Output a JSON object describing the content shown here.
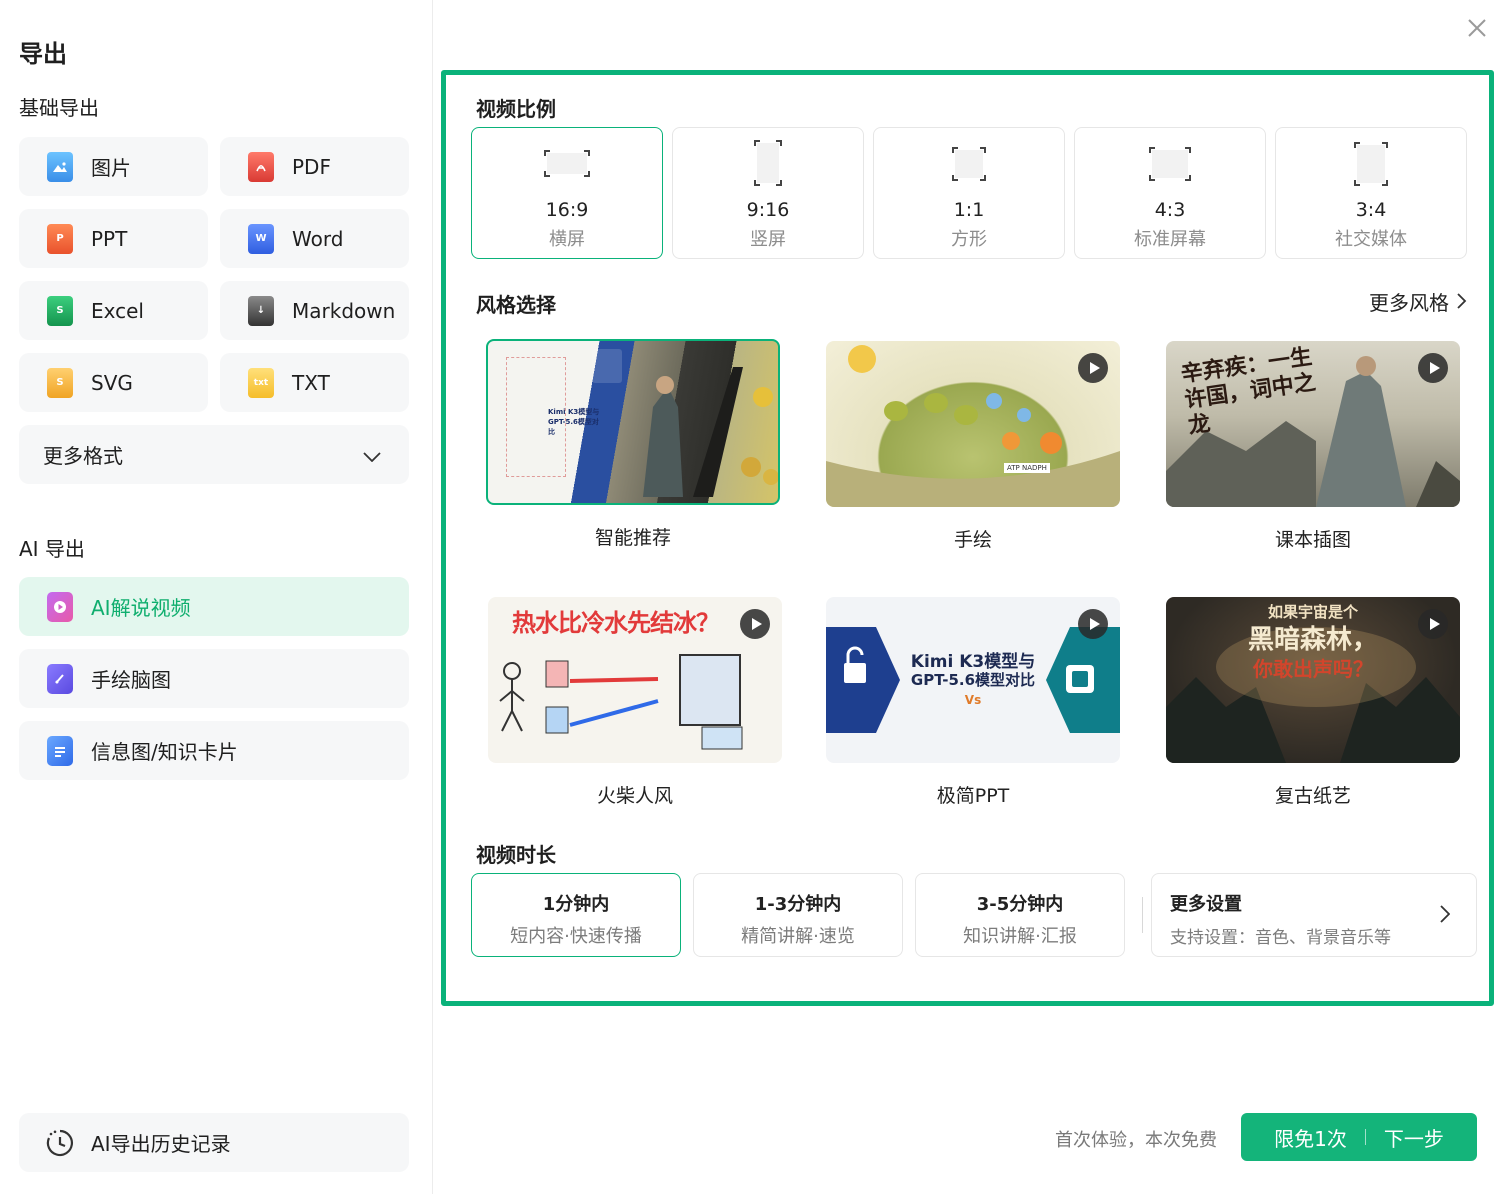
{
  "sidebar": {
    "title": "导出",
    "basic_section": "基础导出",
    "formats": [
      {
        "label": "图片",
        "icon": "image-icon",
        "color": "#3aa6f0"
      },
      {
        "label": "PDF",
        "icon": "pdf-icon",
        "color": "#e9524a"
      },
      {
        "label": "PPT",
        "icon": "ppt-icon",
        "color": "#f06a3a"
      },
      {
        "label": "Word",
        "icon": "word-icon",
        "color": "#3b6ee8"
      },
      {
        "label": "Excel",
        "icon": "excel-icon",
        "color": "#1da35c"
      },
      {
        "label": "Markdown",
        "icon": "markdown-icon",
        "color": "#555555"
      },
      {
        "label": "SVG",
        "icon": "svg-icon",
        "color": "#f2b33a"
      },
      {
        "label": "TXT",
        "icon": "txt-icon",
        "color": "#f5c33a"
      }
    ],
    "more_formats": "更多格式",
    "ai_section": "AI 导出",
    "ai_items": [
      {
        "label": "AI解说视频",
        "icon": "video-icon"
      },
      {
        "label": "手绘脑图",
        "icon": "mindmap-icon"
      },
      {
        "label": "信息图/知识卡片",
        "icon": "infographic-icon"
      }
    ],
    "history": "AI导出历史记录"
  },
  "main": {
    "ratio_title": "视频比例",
    "ratios": [
      {
        "value": "16:9",
        "sub": "横屏"
      },
      {
        "value": "9:16",
        "sub": "竖屏"
      },
      {
        "value": "1:1",
        "sub": "方形"
      },
      {
        "value": "4:3",
        "sub": "标准屏幕"
      },
      {
        "value": "3:4",
        "sub": "社交媒体"
      }
    ],
    "style_title": "风格选择",
    "more_styles": "更多风格",
    "styles": [
      {
        "label": "智能推荐",
        "thumb_text": "Kimi K3模型与 GPT-5.6模型对比"
      },
      {
        "label": "手绘",
        "thumb_text": "ATP NADPH"
      },
      {
        "label": "课本插图",
        "thumb_text": "辛弃疾：一生许国，词中之龙"
      },
      {
        "label": "火柴人风",
        "thumb_text": "热水比冷水先结冰？"
      },
      {
        "label": "极简PPT",
        "thumb_text_1": "Kimi K3模型与",
        "thumb_text_2": "GPT-5.6模型对比",
        "thumb_vs": "Vs"
      },
      {
        "label": "复古纸艺",
        "thumb_text_1": "如果宇宙是个",
        "thumb_text_2": "黑暗森林，",
        "thumb_text_3": "你敢出声吗？"
      }
    ],
    "duration_title": "视频时长",
    "durations": [
      {
        "main": "1分钟内",
        "sub": "短内容·快速传播"
      },
      {
        "main": "1-3分钟内",
        "sub": "精简讲解·速览"
      },
      {
        "main": "3-5分钟内",
        "sub": "知识讲解·汇报"
      }
    ],
    "settings": {
      "title": "更多设置",
      "sub": "支持设置：音色、背景音乐等"
    }
  },
  "footer": {
    "note": "首次体验，本次免费",
    "free_label": "限免1次",
    "next_label": "下一步"
  },
  "colors": {
    "accent": "#0ab27a",
    "button": "#14b47a"
  }
}
